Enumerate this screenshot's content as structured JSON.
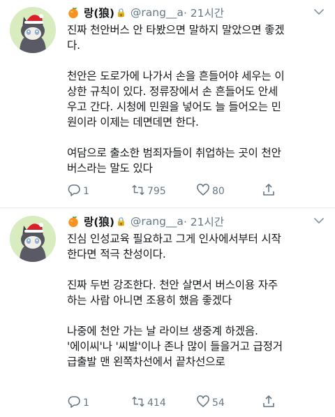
{
  "tweets": [
    {
      "display_name": "랑(狼)",
      "handle": "@rang__a",
      "time": "· 21시간",
      "paragraphs": [
        [
          "진짜 천안버스 안 타봤으면 말하지 말았으면 좋겠",
          "다."
        ],
        [
          "천안은 도로가에 나가서 손을 흔들어야 세우는 이",
          "상한 규칙이 있다. 정류장에서 손 흔들어도 안세",
          "우고 간다. 시청에 민원을 넣어도 늘 들어오는 민",
          "원이라 이제는 데면데면 한다."
        ],
        [
          "여담으로 출소한 범죄자들이 취업하는 곳이 천안",
          "버스라는 말도 있다"
        ]
      ],
      "replies": "1",
      "retweets": "795",
      "likes": "80"
    },
    {
      "display_name": "랑(狼)",
      "handle": "@rang__a",
      "time": "· 21시간",
      "paragraphs": [
        [
          "진심 인성교육 필요하고 그게 인사에서부터 시작",
          "한다면 적극 찬성이다."
        ],
        [
          "진짜 두번 강조한다. 천안 살면서 버스이용 자주",
          "하는 사람 아니면 조용히 했음 좋겠다"
        ],
        [
          "나중에 천안 가는 날 라이브 생중계 하겠음.",
          "'에이씨'나 '씨발'이나 존나 많이 들을거고 급정거",
          "급출발 맨 왼쪽차선에서 끝차선으로"
        ]
      ],
      "replies": "1",
      "retweets": "414",
      "likes": "54"
    }
  ],
  "icons": {
    "orange": "orange-emoji-icon",
    "lock": "protected-lock-icon",
    "more": "chevron-down-icon",
    "reply": "reply-icon",
    "retweet": "retweet-icon",
    "like": "heart-icon",
    "share": "share-icon"
  },
  "colors": {
    "text": "#14171a",
    "secondary": "#657786",
    "divider": "#e6ecf0",
    "avatar_bg": "#d9ecc0"
  }
}
